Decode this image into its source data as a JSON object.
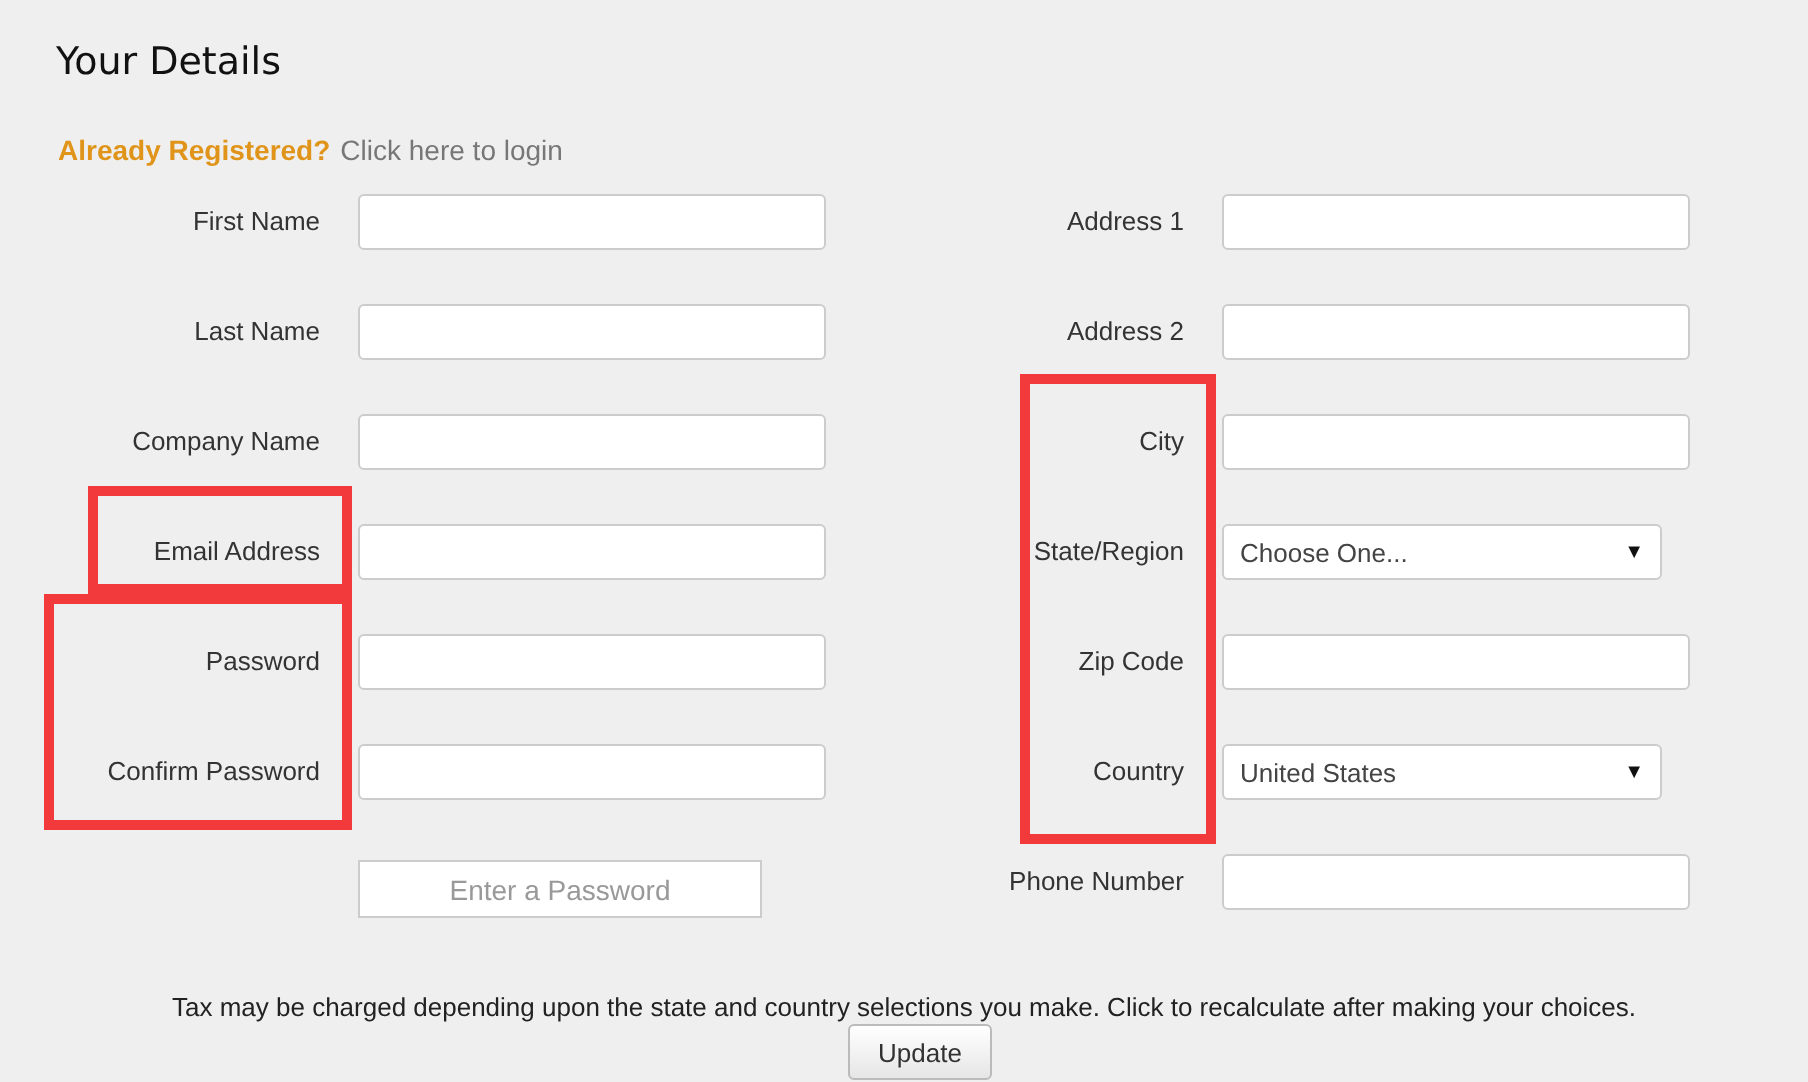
{
  "title": "Your Details",
  "login_prompt": {
    "question": "Already Registered?",
    "link": "Click here to login"
  },
  "left_fields": [
    {
      "label": "First Name",
      "kind": "text"
    },
    {
      "label": "Last Name",
      "kind": "text"
    },
    {
      "label": "Company Name",
      "kind": "text"
    },
    {
      "label": "Email Address",
      "kind": "text"
    },
    {
      "label": "Password",
      "kind": "text"
    },
    {
      "label": "Confirm Password",
      "kind": "text"
    },
    {
      "kind": "strength",
      "value": "Enter a Password"
    }
  ],
  "right_fields": [
    {
      "label": "Address 1",
      "kind": "text"
    },
    {
      "label": "Address 2",
      "kind": "text"
    },
    {
      "label": "City",
      "kind": "text"
    },
    {
      "label": "State/Region",
      "kind": "select",
      "value": "Choose One...",
      "arrow": "▼"
    },
    {
      "label": "Zip Code",
      "kind": "text"
    },
    {
      "label": "Country",
      "kind": "select",
      "value": "United States",
      "arrow": "▼"
    },
    {
      "label": "Phone Number",
      "kind": "text"
    }
  ],
  "tax_note": "Tax may be charged depending upon the state and country selections you make. Click to recalculate after making your choices.",
  "update_button": "Update"
}
